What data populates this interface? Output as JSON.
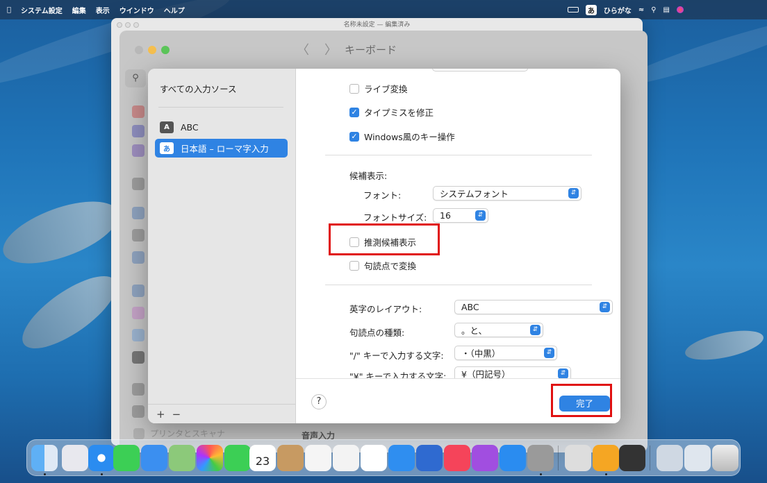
{
  "menubar": {
    "apple": "",
    "app": "システム設定",
    "items": [
      "編集",
      "表示",
      "ウインドウ",
      "ヘルプ"
    ],
    "ime_badge": "あ",
    "ime_label": "ひらがな"
  },
  "back_window": {
    "title": "名称未設定 — 編集済み"
  },
  "settings": {
    "nav_back": "〈",
    "nav_forward": "〉",
    "title": "キーボード",
    "bottom_item": "プリンタとスキャナ",
    "voice_input": "音声入力"
  },
  "sheet": {
    "left": {
      "heading": "すべての入力ソース",
      "sources": [
        {
          "badge": "A",
          "label": "ABC"
        },
        {
          "badge": "あ",
          "label": "日本語 – ローマ字入力"
        }
      ],
      "add": "+",
      "remove": "−"
    },
    "options": {
      "live_conversion": {
        "label": "ライブ変換",
        "checked": false
      },
      "typo_fix": {
        "label": "タイプミスを修正",
        "checked": true
      },
      "windows_keys": {
        "label": "Windows風のキー操作",
        "checked": true
      },
      "candidate_heading": "候補表示:",
      "font_label": "フォント:",
      "font_value": "システムフォント",
      "fontsize_label": "フォントサイズ:",
      "fontsize_value": "16",
      "predictive": {
        "label": "推測候補表示",
        "checked": false
      },
      "punct_convert": {
        "label": "句読点で変換",
        "checked": false
      },
      "layout_label": "英字のレイアウト:",
      "layout_value": "ABC",
      "punct_type_label": "句読点の種類:",
      "punct_type_value": "。と、",
      "slash_label": "\"/\" キーで入力する文字:",
      "slash_value": "・（中黒）",
      "yen_label": "\"¥\" キーで入力する文字:",
      "yen_value": "¥（円記号）"
    },
    "help": "?",
    "done": "完了"
  },
  "dock": {
    "calendar_day": "23"
  },
  "colors": {
    "accent": "#2f83e3",
    "highlight": "#e01010"
  }
}
